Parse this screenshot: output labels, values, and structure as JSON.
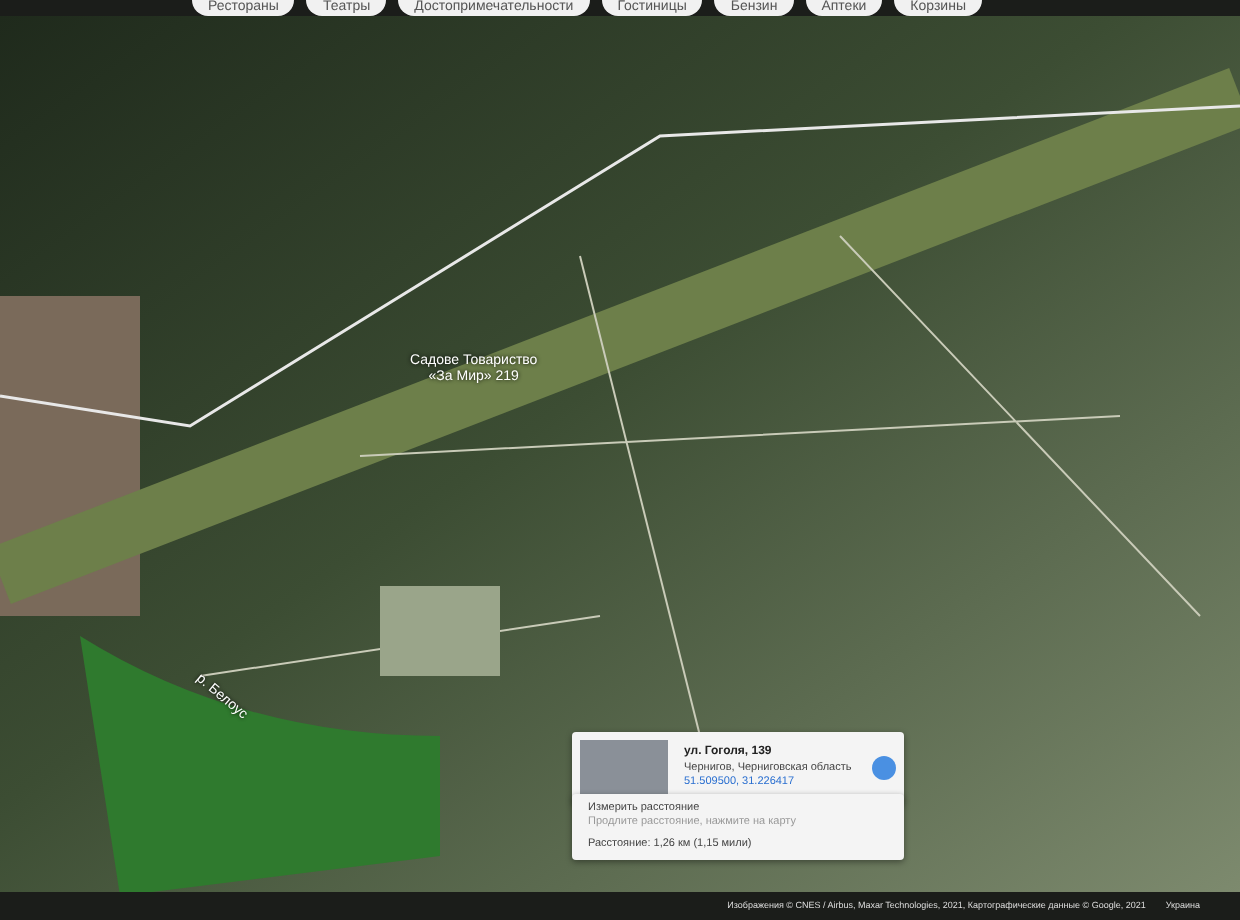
{
  "chips": [
    {
      "label": "Рестораны"
    },
    {
      "label": "Театры"
    },
    {
      "label": "Достопримечательности"
    },
    {
      "label": "Гостиницы"
    },
    {
      "label": "Бензин"
    },
    {
      "label": "Аптеки"
    },
    {
      "label": "Корзины"
    }
  ],
  "map_labels": [
    {
      "kind": "place",
      "text": "Садове Товариство\n«За Мир» 219"
    },
    {
      "kind": "river",
      "text": "р. Белоус"
    }
  ],
  "place_card": {
    "title": "ул. Гоголя, 139",
    "subtitle": "Чернигов, Черниговская область",
    "coords": "51.509500, 31.226417"
  },
  "measure_card": {
    "title": "Измерить расстояние",
    "hint": "Продлите расстояние, нажмите на карту",
    "distance": "Расстояние: 1,26 км (1,15 мили)"
  },
  "attribution": {
    "text": "Изображения © CNES / Airbus, Maxar Technologies, 2021, Картографические данные © Google, 2021",
    "region": "Украина"
  }
}
